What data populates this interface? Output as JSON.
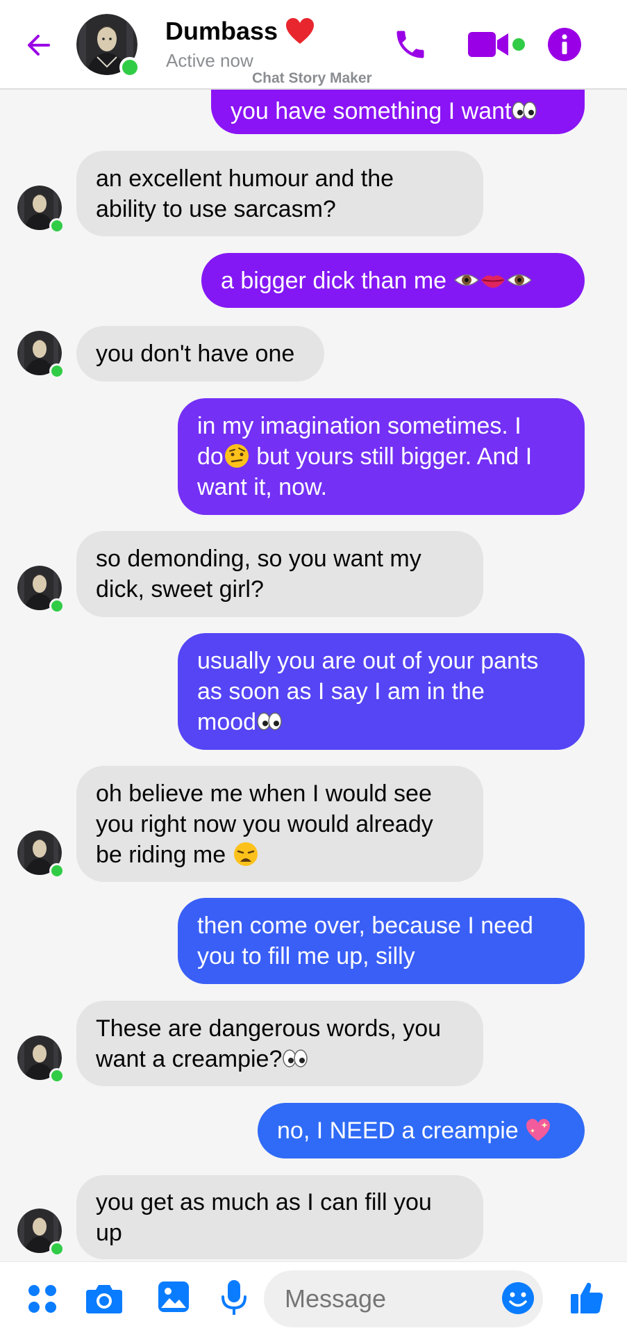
{
  "header": {
    "contact_name": "Dumbass",
    "status": "Active now",
    "watermark": "Chat Story Maker",
    "accent_color": "#9a00e6",
    "online_color": "#31cc46"
  },
  "messages": [
    {
      "side": "out",
      "lines": [
        "you have something I want👀"
      ],
      "color": "#8a14f5"
    },
    {
      "side": "in",
      "lines": [
        "an excellent humour and the",
        "ability to use sarcasm?"
      ]
    },
    {
      "side": "out",
      "lines": [
        "a bigger dick than me 👁️👄👁️"
      ],
      "color": "#8418f4"
    },
    {
      "side": "in",
      "lines": [
        "you don't have one"
      ]
    },
    {
      "side": "out",
      "lines": [
        "in my imagination sometimes. I",
        "do🤨 but yours still bigger. And I",
        "want it, now."
      ],
      "color": "#7430f5"
    },
    {
      "side": "in",
      "lines": [
        "so demonding, so you want my",
        "dick, sweet girl?"
      ]
    },
    {
      "side": "out",
      "lines": [
        "usually you are out of your pants",
        "as soon as I say I am in the",
        "mood👀"
      ],
      "color": "#5545f5"
    },
    {
      "side": "in",
      "lines": [
        "oh believe me when I would see",
        "you right now you would already",
        "be riding me 😩"
      ]
    },
    {
      "side": "out",
      "lines": [
        "then come over, because I need",
        "you to fill me up, silly"
      ],
      "color": "#3a5ff7"
    },
    {
      "side": "in",
      "lines": [
        "These are dangerous words, you",
        "want a creampie?👀"
      ]
    },
    {
      "side": "out",
      "lines": [
        "no, I NEED a creampie 💖"
      ],
      "color": "#2f6bf6"
    },
    {
      "side": "in",
      "lines": [
        "you get as much as I can fill you",
        "up"
      ]
    }
  ],
  "composer": {
    "placeholder": "Message",
    "icons": [
      "apps-icon",
      "camera-icon",
      "gallery-icon",
      "microphone-icon",
      "emoji-icon",
      "thumbs-up-icon"
    ],
    "icon_color": "#0a7cff"
  }
}
